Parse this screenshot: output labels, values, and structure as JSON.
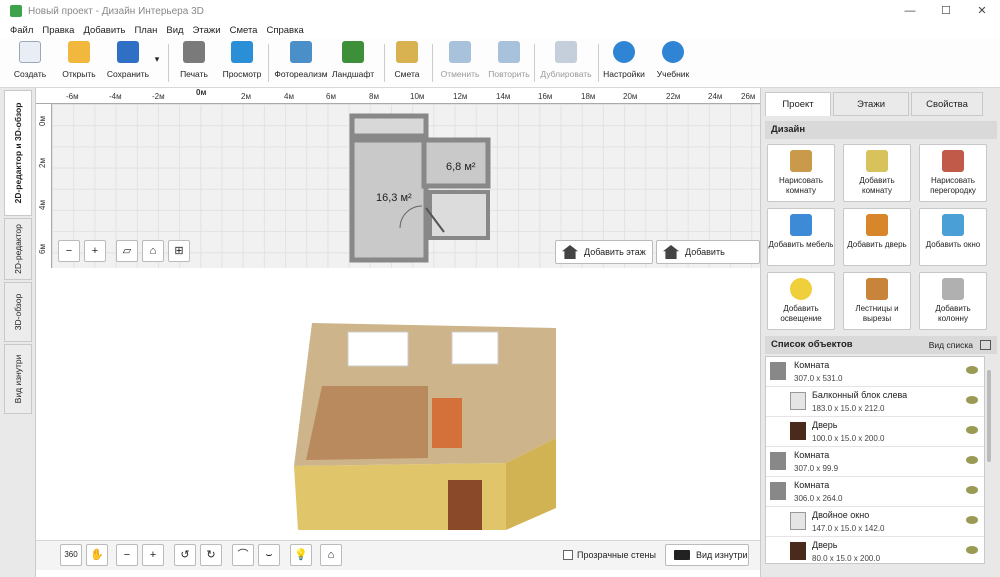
{
  "window": {
    "title": "Новый проект - Дизайн Интерьера 3D",
    "minimize": "—",
    "maximize": "☐",
    "close": "✕"
  },
  "menu": [
    "Файл",
    "Правка",
    "Добавить",
    "План",
    "Вид",
    "Этажи",
    "Смета",
    "Справка"
  ],
  "toolbar": {
    "items": [
      {
        "label": "Создать",
        "icon": "new-file-icon",
        "color": "#e9eef5",
        "disabled": false
      },
      {
        "label": "Открыть",
        "icon": "folder-icon",
        "color": "#f2b73d",
        "disabled": false
      },
      {
        "label": "Сохранить",
        "icon": "save-icon",
        "color": "#2f6fc4",
        "disabled": false
      },
      {
        "label": "Печать",
        "icon": "printer-icon",
        "color": "#7a7a7a",
        "disabled": false
      },
      {
        "label": "Просмотр",
        "icon": "monitor-icon",
        "color": "#2a8fd6",
        "disabled": false
      },
      {
        "label": "Фотореализм",
        "icon": "photo-icon",
        "color": "#4b8fc9",
        "disabled": false
      },
      {
        "label": "Ландшафт",
        "icon": "tree-icon",
        "color": "#3e8f3a",
        "disabled": false
      },
      {
        "label": "Смета",
        "icon": "notepad-icon",
        "color": "#d8b251",
        "disabled": false
      },
      {
        "label": "Отменить",
        "icon": "undo-icon",
        "color": "#a9c2dc",
        "disabled": true
      },
      {
        "label": "Повторить",
        "icon": "redo-icon",
        "color": "#a9c2dc",
        "disabled": true
      },
      {
        "label": "Дублировать",
        "icon": "duplicate-icon",
        "color": "#c4cfdb",
        "disabled": true
      },
      {
        "label": "Настройки",
        "icon": "gear-icon",
        "color": "#2f84d4",
        "disabled": false
      },
      {
        "label": "Учебник",
        "icon": "help-icon",
        "color": "#2f84d4",
        "disabled": false
      }
    ],
    "save_dropdown": "▾"
  },
  "left_tabs": [
    "2D-редактор и 3D-обзор",
    "2D-редактор",
    "3D-обзор",
    "Вид изнутри"
  ],
  "ruler": {
    "top": [
      "-6м",
      "-4м",
      "-2м",
      "0м",
      "2м",
      "4м",
      "6м",
      "8м",
      "10м",
      "12м",
      "14м",
      "16м",
      "18м",
      "20м",
      "22м",
      "24м",
      "26м"
    ],
    "left": [
      "0м",
      "2м",
      "4м",
      "6м"
    ]
  },
  "plan": {
    "room1_area": "16,3 м²",
    "room2_area": "6,8 м²"
  },
  "editor2d_buttons": {
    "add_floor": "Добавить этаж",
    "add_roof": "Добавить крышу"
  },
  "bottom": {
    "transparent_walls_label": "Прозрачные стены",
    "transparent_walls_checked": false,
    "view_inside": "Вид изнутри"
  },
  "right_panel": {
    "tabs": [
      "Проект",
      "Этажи",
      "Свойства"
    ],
    "active_tab": "Проект",
    "design_header": "Дизайн",
    "design_tiles": [
      {
        "label": "Нарисовать комнату",
        "icon": "draw-room-icon",
        "color": "#c99a4a"
      },
      {
        "label": "Добавить комнату",
        "icon": "add-room-icon",
        "color": "#d7c25c"
      },
      {
        "label": "Нарисовать перегородку",
        "icon": "brick-wall-icon",
        "color": "#c25a4a"
      },
      {
        "label": "Добавить мебель",
        "icon": "chair-icon",
        "color": "#3d8bd6"
      },
      {
        "label": "Добавить дверь",
        "icon": "door-icon",
        "color": "#d8862a"
      },
      {
        "label": "Добавить окно",
        "icon": "window-icon",
        "color": "#4aa0d6"
      },
      {
        "label": "Добавить освещение",
        "icon": "bulb-icon",
        "color": "#f0d03a"
      },
      {
        "label": "Лестницы и вырезы",
        "icon": "stairs-icon",
        "color": "#c8843a"
      },
      {
        "label": "Добавить колонну",
        "icon": "column-icon",
        "color": "#b0b0b0"
      }
    ],
    "objects_header": "Список объектов",
    "view_list": "Вид списка",
    "objects": [
      {
        "name": "Комната",
        "dims": "307.0 x 531.0",
        "type": "room"
      },
      {
        "name": "Балконный блок слева",
        "dims": "183.0 x 15.0 x 212.0",
        "type": "window"
      },
      {
        "name": "Дверь",
        "dims": "100.0 x 15.0 x 200.0",
        "type": "door"
      },
      {
        "name": "Комната",
        "dims": "307.0 x 99.9",
        "type": "room"
      },
      {
        "name": "Комната",
        "dims": "306.0 x 264.0",
        "type": "room"
      },
      {
        "name": "Двойное окно",
        "dims": "147.0 x 15.0 x 142.0",
        "type": "window"
      },
      {
        "name": "Дверь",
        "dims": "80.0 x 15.0 x 200.0",
        "type": "door"
      }
    ]
  }
}
